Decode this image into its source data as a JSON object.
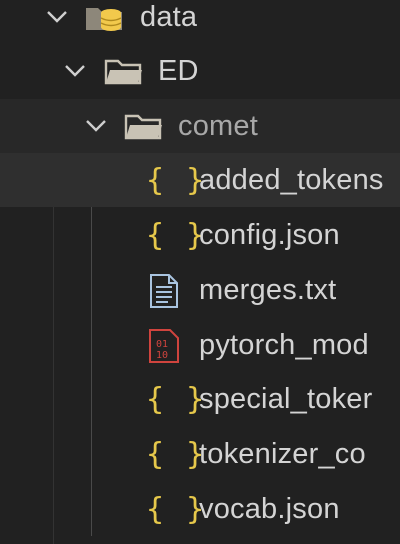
{
  "explorer": {
    "folders": [
      {
        "label": "data",
        "icon": "database-folder-icon",
        "expanded": true
      },
      {
        "label": "ED",
        "icon": "folder-open-icon",
        "expanded": true
      },
      {
        "label": "comet",
        "icon": "folder-open-icon",
        "expanded": true
      }
    ],
    "files": [
      {
        "label": "added_tokens",
        "icon": "json-braces-icon"
      },
      {
        "label": "config.json",
        "icon": "json-braces-icon"
      },
      {
        "label": "merges.txt",
        "icon": "text-file-icon"
      },
      {
        "label": "pytorch_mod",
        "icon": "binary-file-icon"
      },
      {
        "label": "special_toker",
        "icon": "json-braces-icon"
      },
      {
        "label": "tokenizer_co",
        "icon": "json-braces-icon"
      },
      {
        "label": "vocab.json",
        "icon": "json-braces-icon"
      }
    ],
    "brace_glyph": "{ }",
    "binary_glyph_top": "01",
    "binary_glyph_bottom": "10"
  },
  "colors": {
    "background": "#212121",
    "selected_row": "#2f2f2f",
    "hover_row": "#282828",
    "json_icon": "#e6c84b",
    "binary_icon": "#d0443e",
    "folder_icon": "#c9c3b5",
    "text": "#d4d4d4"
  }
}
